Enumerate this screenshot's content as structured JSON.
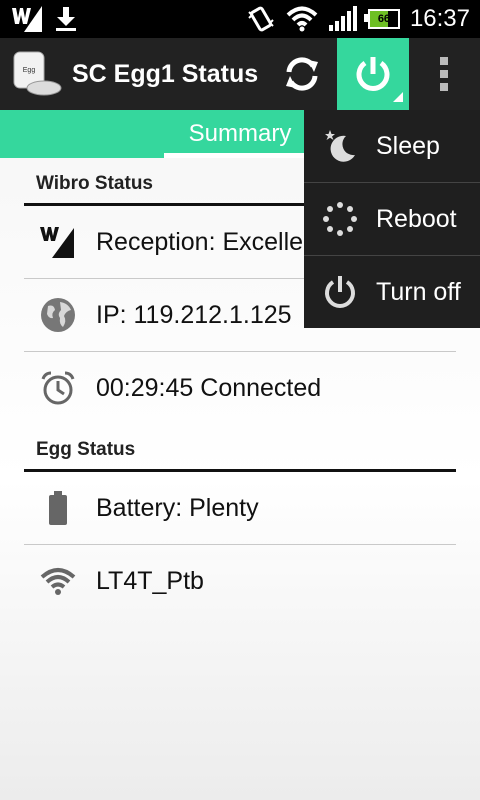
{
  "status_bar": {
    "time": "16:37",
    "battery_level": "66",
    "icons": [
      "wimax-signal-icon",
      "download-icon",
      "vibrate-icon",
      "wifi-icon",
      "cell-signal-icon",
      "battery-icon"
    ]
  },
  "action_bar": {
    "title": "SC Egg1 Status",
    "app_icon_text": "Egg",
    "accent_color": "#35d79d",
    "icons": [
      "refresh-icon",
      "power-icon",
      "overflow-menu-icon"
    ]
  },
  "tabs": [
    {
      "label": "Summary",
      "selected": true
    }
  ],
  "wibro": {
    "header": "Wibro Status",
    "rows": [
      {
        "icon": "wibro-signal-icon",
        "text": "Reception: Excelle"
      },
      {
        "icon": "globe-icon",
        "text": "IP: 119.212.1.125"
      },
      {
        "icon": "alarm-clock-icon",
        "text": "00:29:45 Connected"
      }
    ]
  },
  "egg": {
    "header": "Egg Status",
    "rows": [
      {
        "icon": "battery-icon",
        "text": "Battery: Plenty"
      },
      {
        "icon": "wifi-icon",
        "text": "LT4T_Ptb"
      }
    ]
  },
  "power_menu": {
    "items": [
      {
        "icon": "moon-stars-icon",
        "label": "Sleep"
      },
      {
        "icon": "reboot-icon",
        "label": "Reboot"
      },
      {
        "icon": "power-icon",
        "label": "Turn off"
      }
    ]
  }
}
